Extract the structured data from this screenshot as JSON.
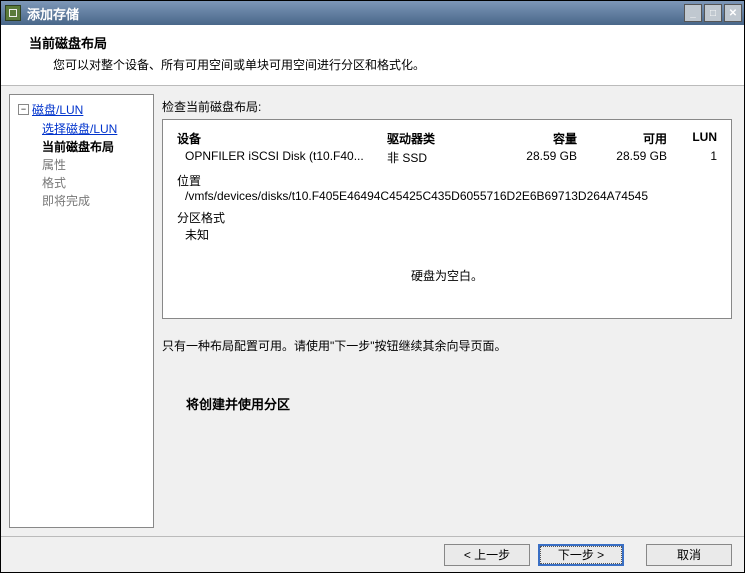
{
  "titlebar": {
    "title": "添加存储"
  },
  "header": {
    "title": "当前磁盘布局",
    "description": "您可以对整个设备、所有可用空间或单块可用空间进行分区和格式化。"
  },
  "sidebar": {
    "root": "磁盘/LUN",
    "items": [
      {
        "label": "选择磁盘/LUN",
        "state": "link"
      },
      {
        "label": "当前磁盘布局",
        "state": "current"
      },
      {
        "label": "属性",
        "state": "disabled"
      },
      {
        "label": "格式",
        "state": "disabled"
      },
      {
        "label": "即将完成",
        "state": "disabled"
      }
    ]
  },
  "main": {
    "review_label": "检查当前磁盘布局:",
    "columns": {
      "device": "设备",
      "drive_type": "驱动器类",
      "capacity": "容量",
      "available": "可用",
      "lun": "LUN"
    },
    "disk": {
      "device": "OPNFILER iSCSI Disk (t10.F40...",
      "drive_type": "非 SSD",
      "capacity": "28.59 GB",
      "available": "28.59 GB",
      "lun": "1"
    },
    "location_label": "位置",
    "location_value": "/vmfs/devices/disks/t10.F405E46494C45425C435D6055716D2E6B69713D264A74545",
    "partition_format_label": "分区格式",
    "partition_format_value": "未知",
    "blank_msg": "硬盘为空白。",
    "instruction": "只有一种布局配置可用。请使用\"下一步\"按钮继续其余向导页面。",
    "action": "将创建并使用分区"
  },
  "footer": {
    "back": "< 上一步",
    "next": "下一步 >",
    "cancel": "取消"
  }
}
